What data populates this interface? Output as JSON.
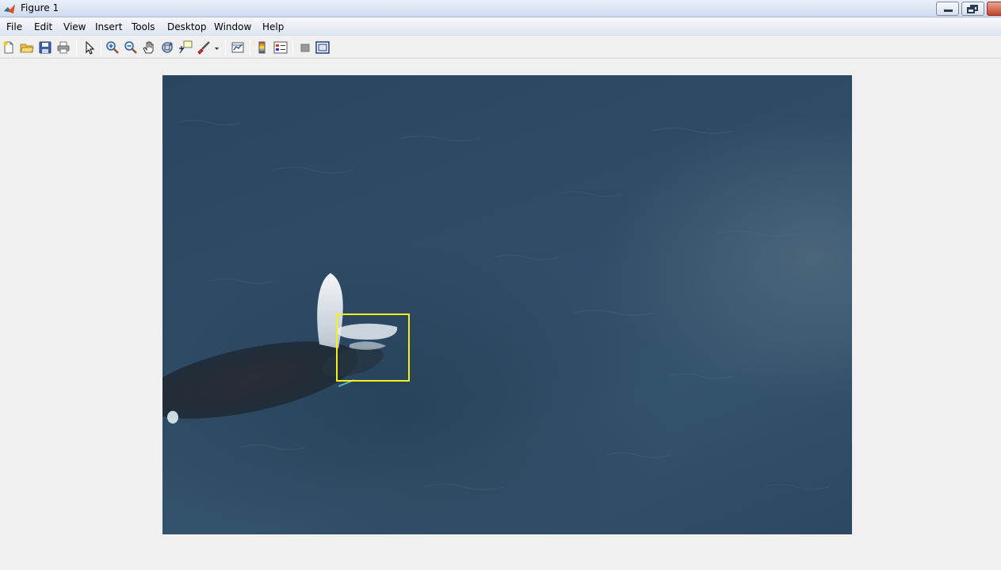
{
  "window": {
    "title": "Figure 1"
  },
  "menu": [
    "File",
    "Edit",
    "View",
    "Insert",
    "Tools",
    "Desktop",
    "Window",
    "Help"
  ],
  "toolbar": {
    "icons": [
      "new-figure-icon",
      "open-file-icon",
      "save-icon",
      "print-icon",
      "edit-plot-arrow-icon",
      "zoom-in-icon",
      "zoom-out-icon",
      "pan-hand-icon",
      "rotate-3d-icon",
      "data-cursor-icon",
      "brush-icon",
      "link-plot-icon",
      "colorbar-icon",
      "legend-icon",
      "hide-plot-tools-icon",
      "show-plot-tools-icon"
    ]
  },
  "figure": {
    "image_subject": "aerial photo of whale spouting at ocean surface",
    "annotation_box_color": "#f6ef1e"
  },
  "colors": {
    "accent": "#f6ef1e",
    "water": "#2f4c67"
  }
}
